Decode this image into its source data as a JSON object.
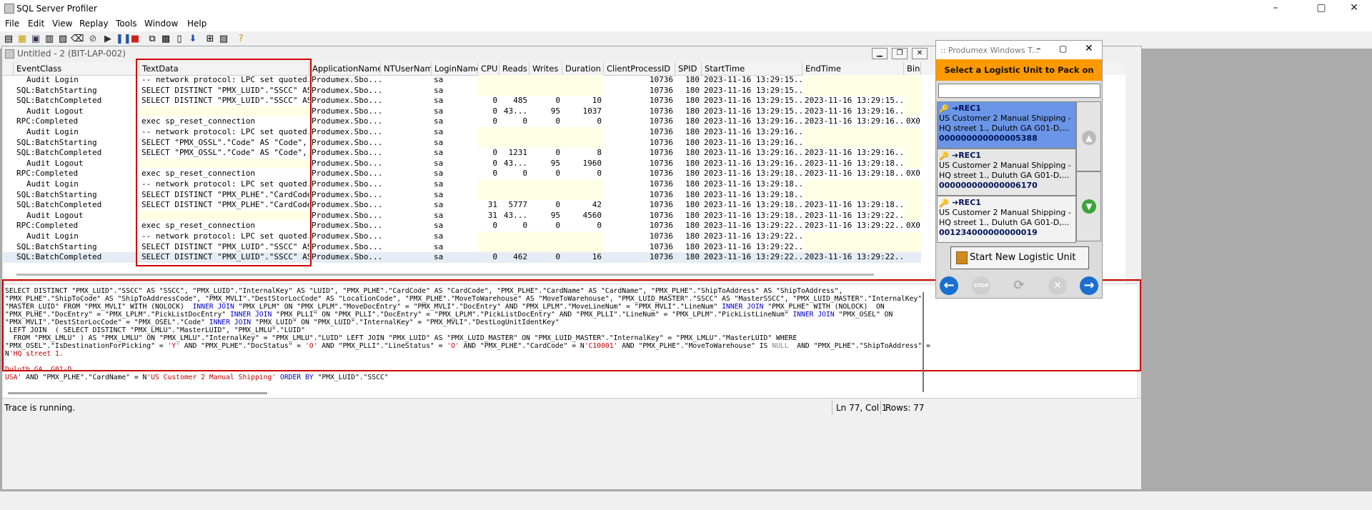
{
  "app": {
    "title": "SQL Server Profiler"
  },
  "menu": [
    "File",
    "Edit",
    "View",
    "Replay",
    "Tools",
    "Window",
    "Help"
  ],
  "window_controls": {
    "minimize": "–",
    "maximize": "▢",
    "close": "✕"
  },
  "toolbar": {
    "icons": [
      "new-trace-icon",
      "open-icon",
      "save-icon",
      "properties-icon",
      "template-icon",
      "clear-icon",
      "start-icon",
      "pause-icon",
      "stop-icon",
      "find-icon",
      "bookmark-icon",
      "column-icon",
      "autoscroll-icon",
      "sql-icon",
      "perf-icon",
      "help-icon"
    ]
  },
  "trace": {
    "title": "Untitled - 2 (BIT-LAP-002)",
    "columns": [
      "EventClass",
      "TextData",
      "ApplicationName",
      "NTUserName",
      "LoginName",
      "CPU",
      "Reads",
      "Writes",
      "Duration",
      "ClientProcessID",
      "SPID",
      "StartTime",
      "EndTime",
      "Binar"
    ],
    "rows": [
      {
        "event": "Audit Login",
        "text": "-- network protocol: LPC  set quoted...",
        "app": "Produmex.Sbo...",
        "login": "sa",
        "cpu": "",
        "reads": "",
        "writes": "",
        "duration": "",
        "pid": "10736",
        "spid": "180",
        "start": "2023-11-16 13:29:15...",
        "end": "",
        "bin": ""
      },
      {
        "event": "SQL:BatchStarting",
        "text": "SELECT DISTINCT \"PMX_LUID\".\"SSCC\" AS...",
        "app": "Produmex.Sbo...",
        "login": "sa",
        "cpu": "",
        "reads": "",
        "writes": "",
        "duration": "",
        "pid": "10736",
        "spid": "180",
        "start": "2023-11-16 13:29:15...",
        "end": "",
        "bin": ""
      },
      {
        "event": "SQL:BatchCompleted",
        "text": "SELECT DISTINCT \"PMX_LUID\".\"SSCC\" AS...",
        "app": "Produmex.Sbo...",
        "login": "sa",
        "cpu": "0",
        "reads": "485",
        "writes": "0",
        "duration": "10",
        "pid": "10736",
        "spid": "180",
        "start": "2023-11-16 13:29:15...",
        "end": "2023-11-16 13:29:15...",
        "bin": ""
      },
      {
        "event": "Audit Logout",
        "text": "",
        "app": "Produmex.Sbo...",
        "login": "sa",
        "cpu": "0",
        "reads": "43...",
        "writes": "95",
        "duration": "1037",
        "pid": "10736",
        "spid": "180",
        "start": "2023-11-16 13:29:15...",
        "end": "2023-11-16 13:29:16...",
        "bin": ""
      },
      {
        "event": "RPC:Completed",
        "text": "exec sp_reset_connection",
        "app": "Produmex.Sbo...",
        "login": "sa",
        "cpu": "0",
        "reads": "0",
        "writes": "0",
        "duration": "0",
        "pid": "10736",
        "spid": "180",
        "start": "2023-11-16 13:29:16...",
        "end": "2023-11-16 13:29:16...",
        "bin": "0X0"
      },
      {
        "event": "Audit Login",
        "text": "-- network protocol: LPC  set quoted...",
        "app": "Produmex.Sbo...",
        "login": "sa",
        "cpu": "",
        "reads": "",
        "writes": "",
        "duration": "",
        "pid": "10736",
        "spid": "180",
        "start": "2023-11-16 13:29:16...",
        "end": "",
        "bin": ""
      },
      {
        "event": "SQL:BatchStarting",
        "text": "SELECT \"PMX_OSSL\".\"Code\" AS \"Code\", ...",
        "app": "Produmex.Sbo...",
        "login": "sa",
        "cpu": "",
        "reads": "",
        "writes": "",
        "duration": "",
        "pid": "10736",
        "spid": "180",
        "start": "2023-11-16 13:29:16...",
        "end": "",
        "bin": ""
      },
      {
        "event": "SQL:BatchCompleted",
        "text": "SELECT \"PMX_OSSL\".\"Code\" AS \"Code\", ...",
        "app": "Produmex.Sbo...",
        "login": "sa",
        "cpu": "0",
        "reads": "1231",
        "writes": "0",
        "duration": "8",
        "pid": "10736",
        "spid": "180",
        "start": "2023-11-16 13:29:16...",
        "end": "2023-11-16 13:29:16...",
        "bin": ""
      },
      {
        "event": "Audit Logout",
        "text": "",
        "app": "Produmex.Sbo...",
        "login": "sa",
        "cpu": "0",
        "reads": "43...",
        "writes": "95",
        "duration": "1960",
        "pid": "10736",
        "spid": "180",
        "start": "2023-11-16 13:29:16...",
        "end": "2023-11-16 13:29:18...",
        "bin": ""
      },
      {
        "event": "RPC:Completed",
        "text": "exec sp_reset_connection",
        "app": "Produmex.Sbo...",
        "login": "sa",
        "cpu": "0",
        "reads": "0",
        "writes": "0",
        "duration": "0",
        "pid": "10736",
        "spid": "180",
        "start": "2023-11-16 13:29:18...",
        "end": "2023-11-16 13:29:18...",
        "bin": "0X0"
      },
      {
        "event": "Audit Login",
        "text": "-- network protocol: LPC  set quoted...",
        "app": "Produmex.Sbo...",
        "login": "sa",
        "cpu": "",
        "reads": "",
        "writes": "",
        "duration": "",
        "pid": "10736",
        "spid": "180",
        "start": "2023-11-16 13:29:18...",
        "end": "",
        "bin": ""
      },
      {
        "event": "SQL:BatchStarting",
        "text": "SELECT DISTINCT \"PMX_PLHE\".\"CardCode...",
        "app": "Produmex.Sbo...",
        "login": "sa",
        "cpu": "",
        "reads": "",
        "writes": "",
        "duration": "",
        "pid": "10736",
        "spid": "180",
        "start": "2023-11-16 13:29:18...",
        "end": "",
        "bin": ""
      },
      {
        "event": "SQL:BatchCompleted",
        "text": "SELECT DISTINCT \"PMX_PLHE\".\"CardCode...",
        "app": "Produmex.Sbo...",
        "login": "sa",
        "cpu": "31",
        "reads": "5777",
        "writes": "0",
        "duration": "42",
        "pid": "10736",
        "spid": "180",
        "start": "2023-11-16 13:29:18...",
        "end": "2023-11-16 13:29:18...",
        "bin": ""
      },
      {
        "event": "Audit Logout",
        "text": "",
        "app": "Produmex.Sbo...",
        "login": "sa",
        "cpu": "31",
        "reads": "43...",
        "writes": "95",
        "duration": "4560",
        "pid": "10736",
        "spid": "180",
        "start": "2023-11-16 13:29:18...",
        "end": "2023-11-16 13:29:22...",
        "bin": ""
      },
      {
        "event": "RPC:Completed",
        "text": "exec sp_reset_connection",
        "app": "Produmex.Sbo...",
        "login": "sa",
        "cpu": "0",
        "reads": "0",
        "writes": "0",
        "duration": "0",
        "pid": "10736",
        "spid": "180",
        "start": "2023-11-16 13:29:22...",
        "end": "2023-11-16 13:29:22...",
        "bin": "0X0"
      },
      {
        "event": "Audit Login",
        "text": "-- network protocol: LPC  set quoted...",
        "app": "Produmex.Sbo...",
        "login": "sa",
        "cpu": "",
        "reads": "",
        "writes": "",
        "duration": "",
        "pid": "10736",
        "spid": "180",
        "start": "2023-11-16 13:29:22...",
        "end": "",
        "bin": ""
      },
      {
        "event": "SQL:BatchStarting",
        "text": "SELECT DISTINCT \"PMX_LUID\".\"SSCC\" AS...",
        "app": "Produmex.Sbo...",
        "login": "sa",
        "cpu": "",
        "reads": "",
        "writes": "",
        "duration": "",
        "pid": "10736",
        "spid": "180",
        "start": "2023-11-16 13:29:22...",
        "end": "",
        "bin": ""
      },
      {
        "event": "SQL:BatchCompleted",
        "text": "SELECT DISTINCT \"PMX_LUID\".\"SSCC\" AS...",
        "app": "Produmex.Sbo...",
        "login": "sa",
        "cpu": "0",
        "reads": "462",
        "writes": "0",
        "duration": "16",
        "pid": "10736",
        "spid": "180",
        "start": "2023-11-16 13:29:22...",
        "end": "2023-11-16 13:29:22...",
        "bin": ""
      }
    ],
    "selected_row": 17
  },
  "sql_text": [
    [
      [
        "SELECT DISTINCT \"PMX_LUID\".\"SSCC\" AS \"SSCC\", \"PMX_LUID\".\"InternalKey\" AS \"LUID\", \"PMX_PLHE\".\"CardCode\" AS \"CardCode\", \"PMX_PLHE\".\"CardName\" AS \"CardName\", \"PMX_PLHE\".\"ShipToAddress\" AS \"ShipToAddress\",",
        "n"
      ]
    ],
    [
      [
        "\"PMX_PLHE\".\"ShipToCode\" AS \"ShipToAddressCode\", \"PMX_MVLI\".\"DestStorLocCode\" AS \"LocationCode\", \"PMX_PLHE\".\"MoveToWarehouse\" AS \"MoveToWarehouse\", \"PMX_LUID_MASTER\".\"SSCC\" AS \"MasterSSCC\", \"PMX_LUID_MASTER\".\"InternalKey\"",
        "n"
      ]
    ],
    [
      [
        "\"MASTER_LUID\" FROM \"PMX_MVLI\" WITH (NOLOCK)  ",
        "n"
      ],
      [
        "INNER JOIN",
        "k"
      ],
      [
        " \"PMX_LPLM\" ON \"PMX_LPLM\".\"MoveDocEntry\" = \"PMX_MVLI\".\"DocEntry\" AND \"PMX_LPLM\".\"MoveLineNum\" = \"PMX_MVLI\".\"LineNum\" ",
        "n"
      ],
      [
        "INNER JOIN",
        "k"
      ],
      [
        " \"PMX_PLHE\" WITH (NOLOCK)  ON",
        "n"
      ]
    ],
    [
      [
        "\"PMX_PLHE\".\"DocEntry\" = \"PMX_LPLM\".\"PickListDocEntry\" ",
        "n"
      ],
      [
        "INNER JOIN",
        "k"
      ],
      [
        " \"PMX_PLLI\" ON \"PMX_PLLI\".\"DocEntry\" = \"PMX_LPLM\".\"PickListDocEntry\" AND \"PMX_PLLI\".\"LineNum\" = \"PMX_LPLM\".\"PickListLineNum\" ",
        "n"
      ],
      [
        "INNER JOIN",
        "k"
      ],
      [
        " \"PMX_OSEL\" ON",
        "n"
      ]
    ],
    [
      [
        "\"PMX_MVLI\".\"DestStorLocCode\" = \"PMX_OSEL\".\"Code\" ",
        "n"
      ],
      [
        "INNER JOIN",
        "k"
      ],
      [
        " \"PMX_LUID\" ON \"PMX_LUID\".\"InternalKey\" = \"PMX_MVLI\".\"DestLogUnitIdentKey\"",
        "n"
      ]
    ],
    [
      [
        " LEFT JOIN  ( SELECT DISTINCT \"PMX_LMLU\".\"MasterLUID\", \"PMX_LMLU\".\"LUID\"",
        "n"
      ]
    ],
    [
      [
        "  FROM \"PMX_LMLU\" ) AS \"PMX_LMLU\" ON \"PMX_LMLU\".\"InternalKey\" = \"PMX_LMLU\".\"LUID\" LEFT JOIN \"PMX_LUID\" AS \"PMX_LUID_MASTER\" ON \"PMX_LUID_MASTER\".\"InternalKey\" = \"PMX_LMLU\".\"MasterLUID\" WHERE",
        "n"
      ]
    ],
    [
      [
        "\"PMX_OSEL\".\"IsDestinationForPicking\" = ",
        "n"
      ],
      [
        "'Y'",
        "s"
      ],
      [
        " AND \"PMX_PLHE\".\"DocStatus\" = ",
        "n"
      ],
      [
        "'O'",
        "s"
      ],
      [
        " AND \"PMX_PLLI\".\"LineStatus\" = ",
        "n"
      ],
      [
        "'O'",
        "s"
      ],
      [
        " AND \"PMX_PLHE\".\"CardCode\" = N",
        "n"
      ],
      [
        "'C10001'",
        "s"
      ],
      [
        " AND \"PMX_PLHE\".\"MoveToWarehouse\" IS ",
        "n"
      ],
      [
        "NULL",
        "g"
      ],
      [
        "  AND \"PMX_PLHE\".\"ShipToAddress\" =",
        "n"
      ]
    ],
    [
      [
        "N",
        "n"
      ],
      [
        "'HQ street 1.",
        "s"
      ]
    ],
    [
      [
        "",
        "n"
      ]
    ],
    [
      [
        "Duluth GA  G01-D",
        "s"
      ]
    ],
    [
      [
        "USA'",
        "s"
      ],
      [
        " AND \"PMX_PLHE\".\"CardName\" = N",
        "n"
      ],
      [
        "'US Customer 2 Manual Shipping'",
        "s"
      ],
      [
        " ",
        "n"
      ],
      [
        "ORDER BY",
        "k"
      ],
      [
        " \"PMX_LUID\".\"SSCC\"",
        "n"
      ]
    ]
  ],
  "status": {
    "left": "Trace is running.",
    "position": "Ln 77, Col 1",
    "rows": "Rows: 77"
  },
  "pmx": {
    "title": ":: Produmex Windows T...",
    "header": "Select a Logistic Unit to Pack on",
    "search_value": "",
    "items": [
      {
        "head": "➔REC1",
        "line1": "US Customer 2 Manual Shipping -",
        "line2": "HQ street 1., Duluth GA  G01-D,...",
        "sscc": "000000000000005388"
      },
      {
        "head": "➔REC1",
        "line1": "US Customer 2 Manual Shipping -",
        "line2": "HQ street 1., Duluth GA  G01-D,...",
        "sscc": "000000000000006170"
      },
      {
        "head": "➔REC1",
        "line1": "US Customer 2 Manual Shipping -",
        "line2": "HQ street 1., Duluth GA  G01-D,...",
        "sscc": "001234000000000019"
      }
    ],
    "start_button": "Start New Logistic Unit",
    "colors": {
      "header": "#ff9900",
      "selected": "#6699ee",
      "nav": "#1a6fd0"
    }
  }
}
